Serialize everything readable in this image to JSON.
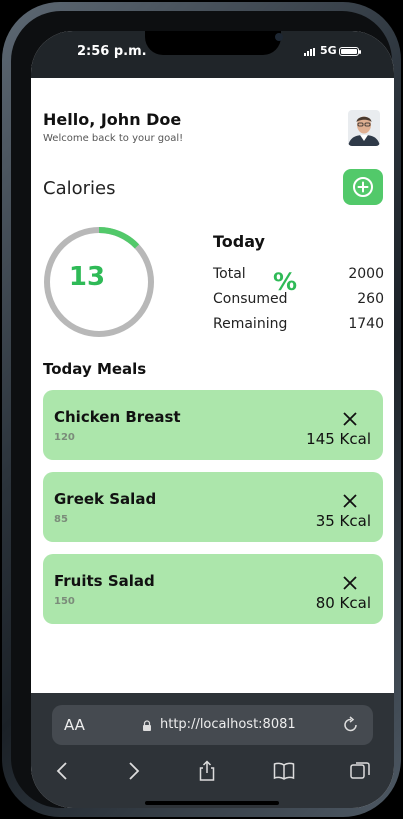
{
  "status": {
    "time": "2:56 p.m.",
    "network": "5G"
  },
  "header": {
    "greeting": "Hello, John Doe",
    "subtitle": "Welcome back to your goal!"
  },
  "calories": {
    "title": "Calories",
    "percent_value": "13",
    "percent_sign": "%",
    "progress_fraction": 0.13,
    "today_label": "Today",
    "stats": [
      {
        "label": "Total",
        "value": "2000"
      },
      {
        "label": "Consumed",
        "value": "260"
      },
      {
        "label": "Remaining",
        "value": "1740"
      }
    ]
  },
  "meals": {
    "title": "Today Meals",
    "items": [
      {
        "name": "Chicken Breast",
        "quantity": "120",
        "kcal": "145 Kcal"
      },
      {
        "name": "Greek Salad",
        "quantity": "85",
        "kcal": "35 Kcal"
      },
      {
        "name": "Fruits Salad",
        "quantity": "150",
        "kcal": "80 Kcal"
      }
    ]
  },
  "browser": {
    "text_size_label": "AA",
    "url": "http://localhost:8081"
  },
  "colors": {
    "accent": "#52c96a",
    "accent_text": "#2fba57",
    "meal_card": "#ace6ab",
    "ring_track": "#b8b8b8"
  },
  "icons": [
    "plus-circle-icon",
    "close-icon",
    "lock-icon",
    "reload-icon",
    "back-icon",
    "forward-icon",
    "share-icon",
    "bookmarks-icon",
    "tabs-icon"
  ]
}
